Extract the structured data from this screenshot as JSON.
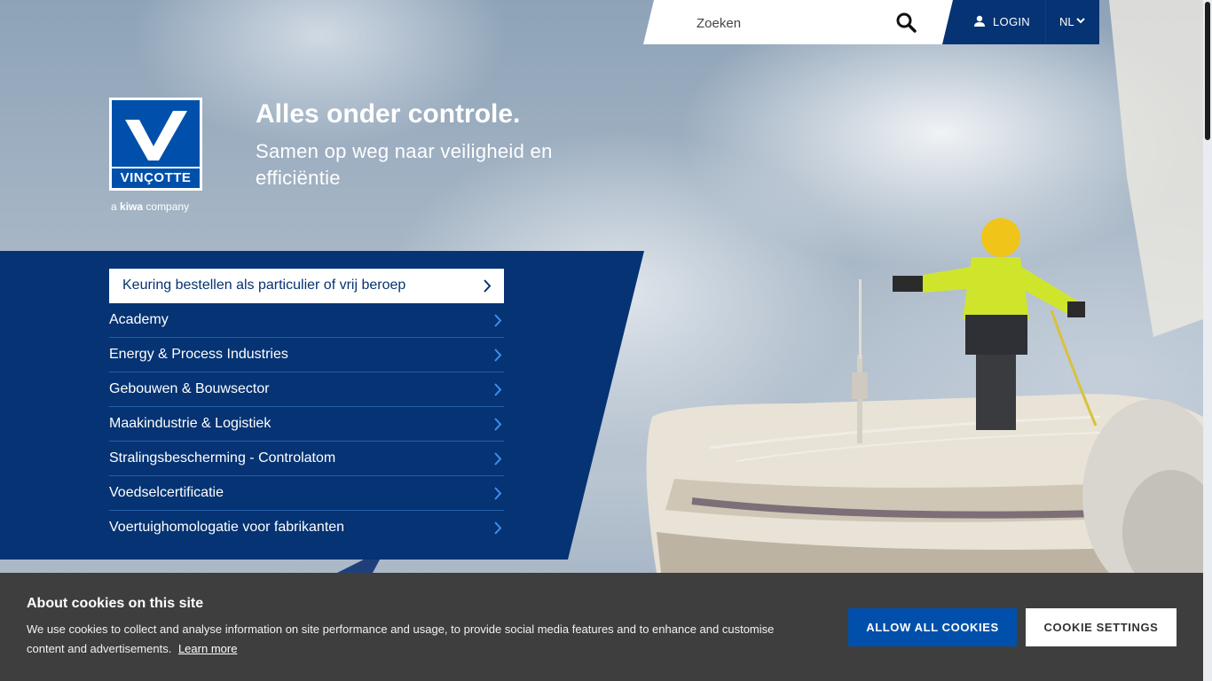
{
  "header": {
    "search": {
      "placeholder": "Zoeken",
      "icon": "search-icon"
    },
    "login": {
      "label": "LOGIN",
      "icon": "user-icon"
    },
    "language": {
      "label": "NL",
      "icon": "chevron-down-icon"
    }
  },
  "logo": {
    "wordmark": "VINÇOTTE",
    "sub_prefix": "a",
    "sub_brand": "kiwa",
    "sub_suffix": "company"
  },
  "hero": {
    "title": "Alles onder controle.",
    "subtitle": "Samen op weg naar veiligheid en efficiëntie"
  },
  "nav": {
    "items": [
      {
        "label": "Keuring bestellen als particulier of vrij beroep"
      },
      {
        "label": "Academy"
      },
      {
        "label": "Energy & Process Industries"
      },
      {
        "label": "Gebouwen & Bouwsector"
      },
      {
        "label": "Maakindustrie & Logistiek"
      },
      {
        "label": "Stralingsbescherming - Controlatom"
      },
      {
        "label": "Voedselcertificatie"
      },
      {
        "label": "Voertuighomologatie voor fabrikanten"
      }
    ]
  },
  "cookie": {
    "title": "About cookies on this site",
    "text": "We use cookies to collect and analyse information on site performance and usage, to provide social media features and to enhance and customise content and advertisements.",
    "learn_more": "Learn more",
    "allow_all": "ALLOW ALL COOKIES",
    "settings": "COOKIE SETTINGS"
  },
  "colors": {
    "brand_blue": "#053373",
    "accent_blue": "#0050ab",
    "cookie_bg": "#3e3e3e"
  }
}
